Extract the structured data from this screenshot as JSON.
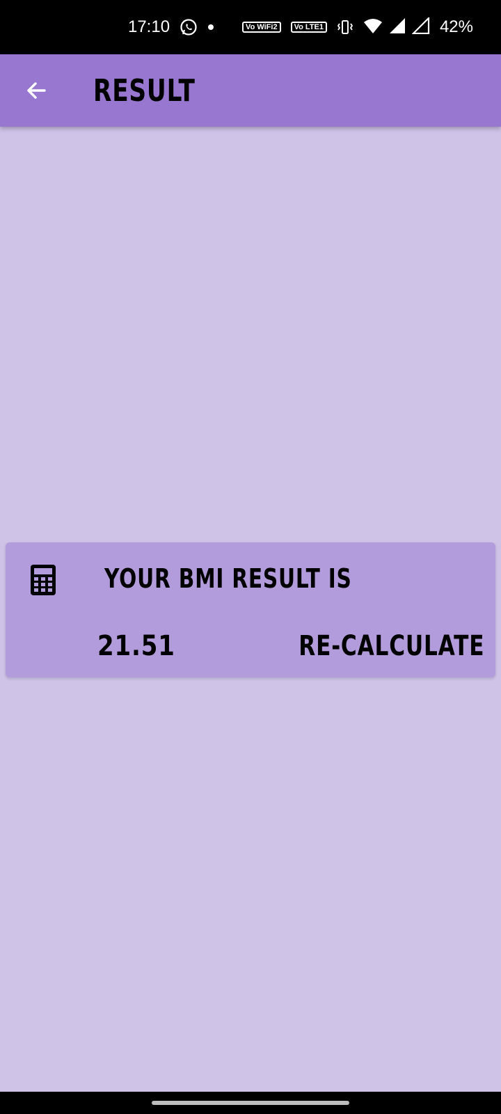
{
  "status_bar": {
    "time": "17:10",
    "badge_wifi": "Vo WiFi2",
    "badge_lte": "Vo LTE1",
    "battery": "42%",
    "icons": [
      "whatsapp-icon",
      "dot-icon",
      "vowifi-icon",
      "volte-icon",
      "vibrate-icon",
      "wifi-icon",
      "signal-icon",
      "signal-icon",
      "battery-text"
    ]
  },
  "app_bar": {
    "title": "RESULT",
    "back_icon": "arrow-left-icon",
    "color": "#9777CF"
  },
  "card": {
    "heading": "YOUR BMI RESULT IS",
    "icon": "calculator-icon",
    "bmi_value": "21.51",
    "recalculate_label": "RE-CALCULATE",
    "color": "#B29CDB"
  },
  "colors": {
    "background": "#CFC3E8",
    "app_bar": "#9777CF",
    "card": "#B29CDB"
  }
}
